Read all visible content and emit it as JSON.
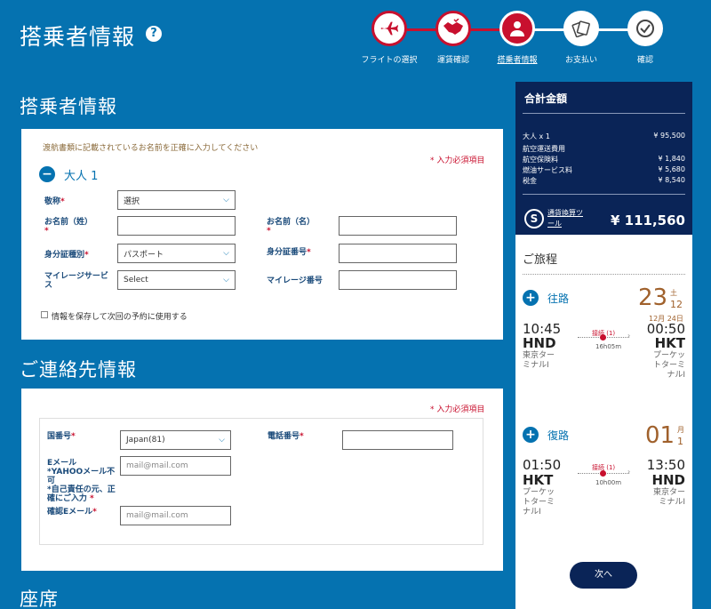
{
  "header": {
    "title": "搭乗者情報",
    "help": "?",
    "steps": [
      {
        "label": "フライトの選択",
        "icon": "plane-icon",
        "state": "done"
      },
      {
        "label": "運賃確認",
        "icon": "handshake-icon",
        "state": "done"
      },
      {
        "label": "搭乗者情報",
        "icon": "person-icon",
        "state": "current"
      },
      {
        "label": "お支払い",
        "icon": "payment-icon",
        "state": "todo"
      },
      {
        "label": "確認",
        "icon": "check-icon",
        "state": "todo"
      }
    ]
  },
  "passenger": {
    "section_title": "搭乗者情報",
    "hint": "渡航書類に記載されているお名前を正確に入力してください",
    "required": "* 入力必須項目",
    "group": "大人 1",
    "title_label": "敬称",
    "title_value": "選択",
    "last_name_label": "お名前（姓）",
    "first_name_label": "お名前（名）",
    "id_type_label": "身分証種別",
    "id_type_value": "パスポート",
    "id_number_label": "身分証番号",
    "mileage_label": "マイレージサービス",
    "mileage_value": "Select",
    "mileage_number_label": "マイレージ番号",
    "save_label": "情報を保存して次回の予約に使用する"
  },
  "contact": {
    "section_title": "ご連絡先情報",
    "required": "* 入力必須項目",
    "country_label": "国番号",
    "country_value": "Japan(81)",
    "phone_label": "電話番号",
    "email_label": "Eメール",
    "email_note1": "*YAHOOメール不可",
    "email_note2": "*自己責任の元、正確にご入力",
    "email_placeholder": "mail@mail.com",
    "confirm_label": "確認Eメール",
    "confirm_placeholder": "mail@mail.com"
  },
  "seat": {
    "section_title": "座席"
  },
  "summary": {
    "title": "合計金額",
    "pax": "大人 x 1",
    "pax_amount": "¥ 95,500",
    "fee_title": "航空運送費用",
    "rows": [
      {
        "label": "航空保険料",
        "amount": "¥ 1,840"
      },
      {
        "label": "燃油サービス料",
        "amount": "¥ 5,680"
      },
      {
        "label": "税金",
        "amount": "¥ 8,540"
      }
    ],
    "converter": "通貨換算ツール",
    "total": "¥ 111,560"
  },
  "itinerary": {
    "title": "ご旅程",
    "outbound": {
      "label": "往路",
      "day": "23",
      "weekday": "土",
      "month": "12",
      "arrival_date": "12月 24日",
      "dep_time": "10:45",
      "dep_code": "HND",
      "dep_city": "東京ターミナルI",
      "stop": "接続 (1)",
      "duration": "16h05m",
      "arr_time": "00:50",
      "arr_code": "HKT",
      "arr_city": "プーケットターミナルI"
    },
    "inbound": {
      "label": "復路",
      "day": "01",
      "weekday": "月",
      "month": "1",
      "dep_time": "01:50",
      "dep_code": "HKT",
      "dep_city": "プーケットターミナルI",
      "stop": "接続 (1)",
      "duration": "10h00m",
      "arr_time": "13:50",
      "arr_code": "HND",
      "arr_city": "東京ターミナルI"
    },
    "next": "次へ"
  },
  "colors": {
    "brand_blue": "#0572b0",
    "navy": "#0a2457",
    "red": "#c8102e",
    "gold": "#a0612c"
  }
}
